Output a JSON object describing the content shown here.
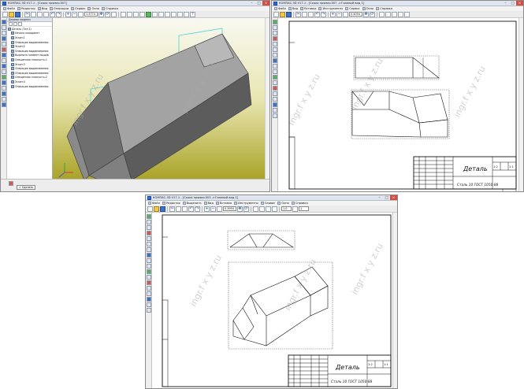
{
  "windows": [
    {
      "title": "КОМПАС-3D V17.1 - [Скала прямая.007]",
      "menu": [
        "Файл",
        "Редактор",
        "Вид",
        "Операции",
        "Сервис",
        "Окно",
        "Справка"
      ],
      "zoom": "1.4774",
      "tree": {
        "header": "Дерево модели",
        "items": [
          {
            "label": "Деталь (Тел-1)",
            "level": 0
          },
          {
            "label": "Начало координат",
            "level": 1
          },
          {
            "label": "Эскиз:1",
            "level": 1
          },
          {
            "label": "Операция выдавливания:",
            "level": 1
          },
          {
            "label": "Эскиз:2",
            "level": 1
          },
          {
            "label": "Операция выдавливания:",
            "level": 1
          },
          {
            "label": "Вырезать элемент выдав",
            "level": 1
          },
          {
            "label": "Смещенная плоскость:1",
            "level": 1
          },
          {
            "label": "Эскиз:3",
            "level": 1
          },
          {
            "label": "Операция выдавливания:",
            "level": 1
          },
          {
            "label": "Операция выдавливания:",
            "level": 1
          },
          {
            "label": "Смещенная плоскость:2",
            "level": 1
          },
          {
            "label": "Эскиз:4",
            "level": 1
          },
          {
            "label": "Операция выдавливания:",
            "level": 1
          }
        ],
        "tab": "Построение"
      },
      "status_button": "Сделать"
    },
    {
      "title": "КОМПАС-3D V17.1 - [Скала прямая.007 ->Главный вид 1]",
      "menu": [
        "Файл",
        "Вид",
        "Вставка",
        "Инструменты",
        "Сервис",
        "Окно",
        "Справка"
      ],
      "zoom": "0.4094",
      "stamp": {
        "name": "Деталь",
        "material": "Сталь 10 ГОСТ 1050-88",
        "mass": "1:2",
        "scale": "1:1"
      }
    },
    {
      "title": "КОМПАС-3D V17.1 - [Скала прямая.003 ->Главный вид 1]",
      "menu": [
        "Файл",
        "Редактор",
        "Выделить",
        "Вид",
        "Вставка",
        "Инструменты",
        "Сервис",
        "Окно",
        "Справка"
      ],
      "zoom": "0.3994",
      "style_combo": "1.0",
      "stamp": {
        "name": "Деталь",
        "material": "Сталь 10 ГОСТ 1050-88",
        "mass": "1:2",
        "scale": "1:1"
      }
    }
  ],
  "watermark": "ingr.f x y z.ru",
  "colors": {
    "accent": "#3c73c9",
    "viewport_top": "#f9f9f2",
    "viewport_bottom": "#a9a226",
    "model": "#6f6f6f",
    "close": "#d64b42"
  }
}
